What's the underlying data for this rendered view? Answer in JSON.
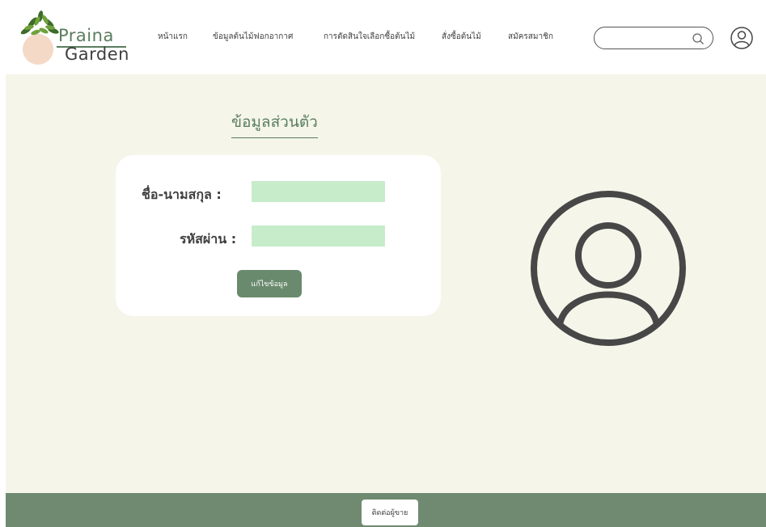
{
  "brand": {
    "line1": "Praina",
    "line2": "Garden"
  },
  "nav": {
    "items": [
      {
        "label": "หน้าแรก"
      },
      {
        "label": "ข้อมูลต้นไม้ฟอกอากาศ"
      },
      {
        "label": "การตัดสินใจเลือกซื้อต้นไม้"
      },
      {
        "label": "สั่งซื้อต้นไม้"
      },
      {
        "label": "สมัครสมาชิก"
      }
    ]
  },
  "search": {
    "value": "",
    "placeholder": ""
  },
  "profile": {
    "title": "ข้อมูลส่วนตัว",
    "name_label": "ชื่อ-นามสกุล :",
    "name_value": "",
    "password_label": "รหัสผ่าน :",
    "password_value": "",
    "edit_button": "แก้ไขข้อมูล"
  },
  "footer": {
    "contact_button": "ติดต่อผู้ขาย"
  },
  "colors": {
    "brand_green": "#5a7d5e",
    "button_green": "#6a8a6d",
    "footer_green": "#6f8a70",
    "input_fill": "#c7ecca",
    "page_bg": "#f5f5ea"
  },
  "icons": {
    "logo": "plant-pot-logo",
    "search": "search-icon",
    "user": "user-circle-icon",
    "avatar": "user-avatar-icon"
  }
}
